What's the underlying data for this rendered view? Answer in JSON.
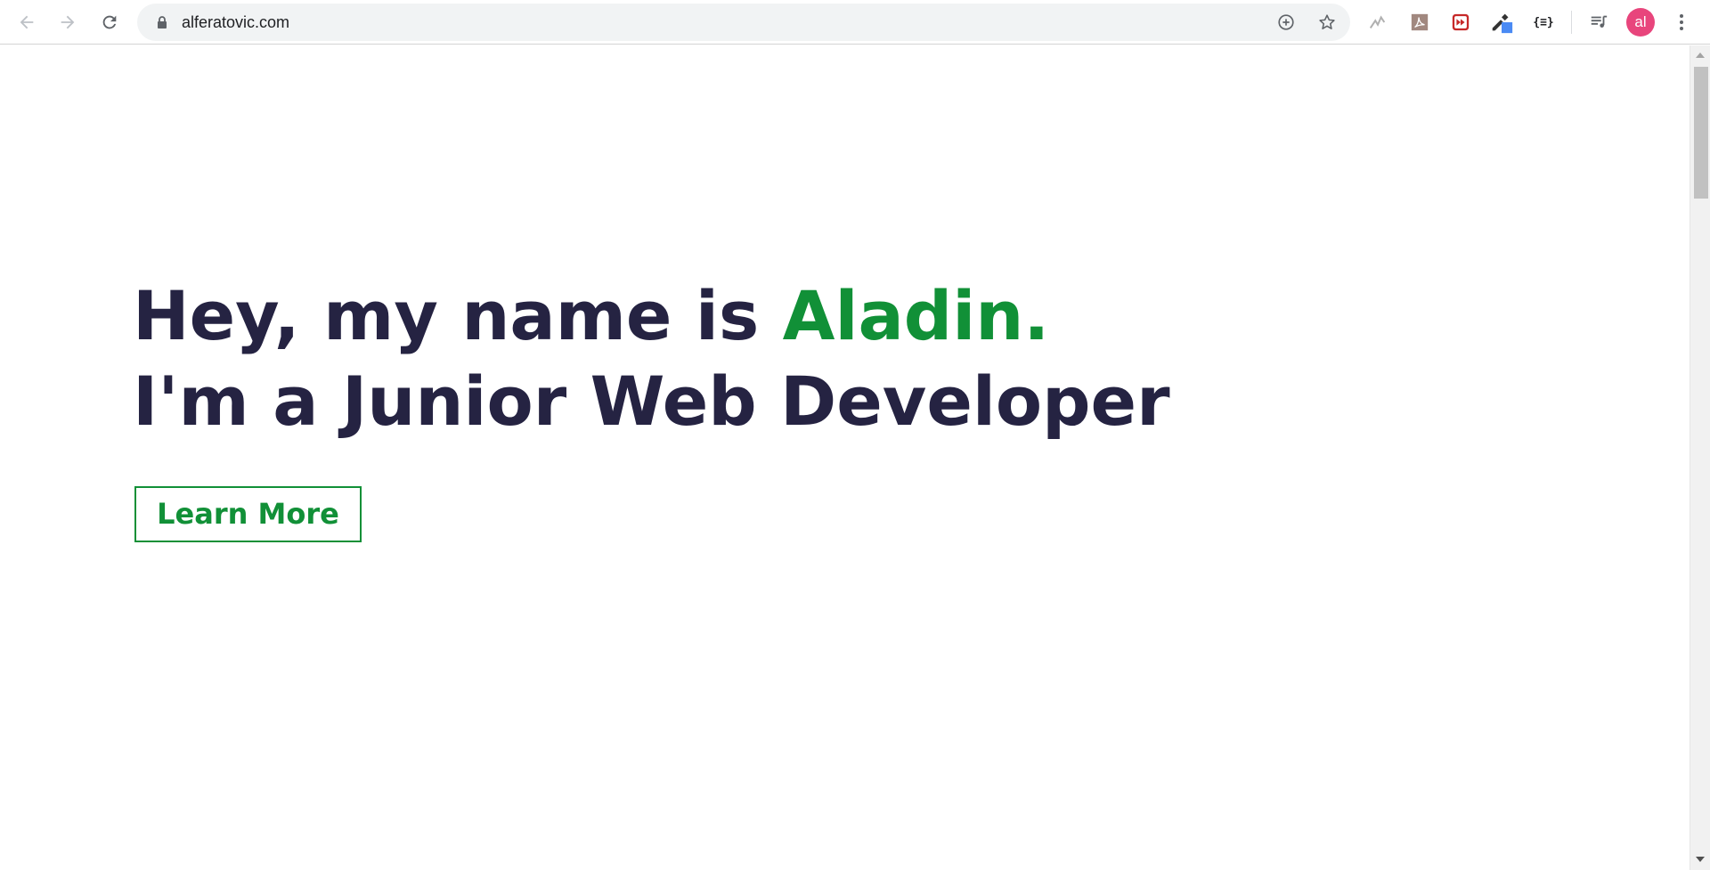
{
  "browser": {
    "url": "alferatovic.com",
    "back_icon": "arrow-left",
    "forward_icon": "arrow-right",
    "reload_icon": "reload",
    "lock_icon": "lock",
    "zoom_icon": "zoom-plus",
    "bookmark_icon": "star",
    "extensions": [
      {
        "name": "wave-extension-icon"
      },
      {
        "name": "pdf-extension-icon"
      },
      {
        "name": "fast-forward-extension-icon"
      },
      {
        "name": "color-picker-extension-icon"
      },
      {
        "name": "json-formatter-extension-icon",
        "label": "{≡}"
      },
      {
        "name": "playlist-extension-icon"
      }
    ],
    "avatar_text": "al",
    "avatar_color": "#e8457c"
  },
  "hero": {
    "line1_prefix": "Hey, my name is ",
    "line1_accent": "Aladin.",
    "line2": "I'm a Junior Web Developer",
    "cta_label": "Learn More"
  },
  "colors": {
    "heading": "#252342",
    "accent": "#119037"
  }
}
